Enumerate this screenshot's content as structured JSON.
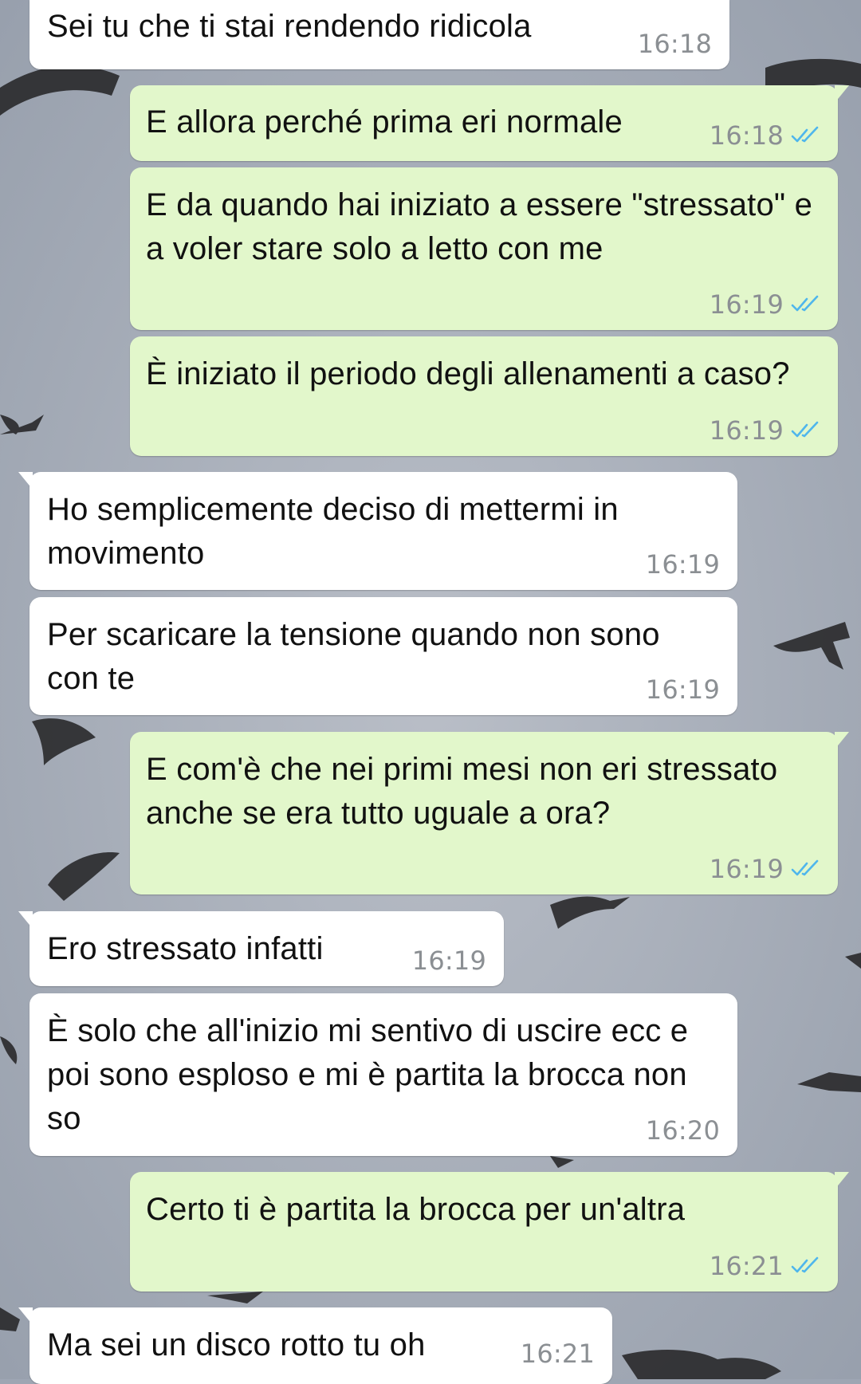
{
  "chat": {
    "messages": [
      {
        "direction": "in",
        "text": "Sei tu che ti stai rendendo ridicola",
        "time": "16:18"
      },
      {
        "direction": "out",
        "text": "E allora perché prima eri normale",
        "time": "16:18",
        "status": "read"
      },
      {
        "direction": "out",
        "text": "E da quando hai iniziato a essere \"stressato\" e a voler stare solo a letto con me",
        "time": "16:19",
        "status": "read"
      },
      {
        "direction": "out",
        "text": "È iniziato il periodo degli allenamenti a caso?",
        "time": "16:19",
        "status": "read"
      },
      {
        "direction": "in",
        "text": "Ho semplicemente deciso di mettermi in movimento",
        "time": "16:19"
      },
      {
        "direction": "in",
        "text": "Per scaricare la tensione quando non sono con te",
        "time": "16:19"
      },
      {
        "direction": "out",
        "text": "E com'è che nei primi mesi non eri stressato anche se era tutto uguale a ora?",
        "time": "16:19",
        "status": "read"
      },
      {
        "direction": "in",
        "text": "Ero stressato infatti",
        "time": "16:19"
      },
      {
        "direction": "in",
        "text": "È solo che all'inizio mi sentivo di uscire ecc e poi sono esploso e mi è partita la brocca non so",
        "time": "16:20"
      },
      {
        "direction": "out",
        "text": "Certo ti è partita la brocca per un'altra",
        "time": "16:21",
        "status": "read"
      },
      {
        "direction": "in",
        "text": "Ma sei un disco rotto tu oh",
        "time": "16:21"
      }
    ]
  },
  "icons": {
    "read_receipt": "double-check-icon"
  },
  "colors": {
    "incoming_bubble": "#ffffff",
    "outgoing_bubble": "#e2f7cb",
    "timestamp": "#8b8f93",
    "read_ticks": "#4fb6ec",
    "wallpaper_sky": "#a8b0bb"
  }
}
